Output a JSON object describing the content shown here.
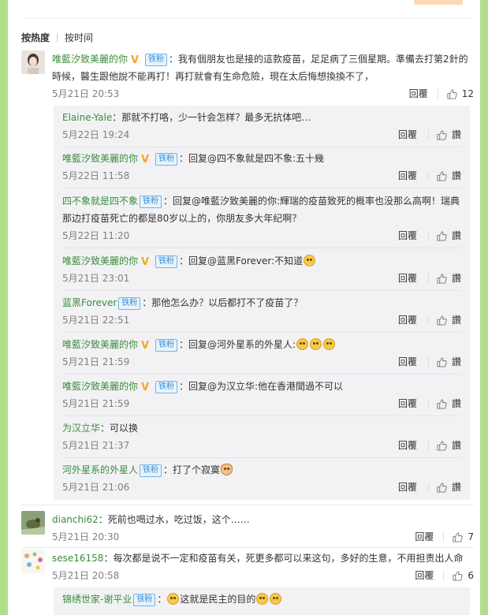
{
  "tabs": [
    {
      "label": "按热度",
      "active": true
    },
    {
      "label": "按时间",
      "active": false
    }
  ],
  "reply_label": "回覆",
  "like_label": "讚",
  "comments": [
    {
      "user": "唯藍汐致美麗的你",
      "fan_badge": "铁粉",
      "verified": true,
      "text": "：我有個朋友也是接的這款疫苗，足足病了三個星期。準備去打第2針的時候，醫生跟他說不能再打！再打就會有生命危險，現在太后悔想換換不了，",
      "time": "5月21日 20:53",
      "likes": "12",
      "replies": [
        {
          "user": "Elaine-Yale",
          "verified": false,
          "fan_badge": "",
          "text": "：那就不打咯，少一针会怎样？最多无抗体吧…",
          "time": "5月22日 19:24"
        },
        {
          "user": "唯藍汐致美麗的你",
          "verified": true,
          "fan_badge": "铁粉",
          "text": "：回复@四不象就是四不象:五十幾",
          "time": "5月22日 11:58"
        },
        {
          "user": "四不象就是四不象",
          "verified": false,
          "fan_badge": "铁粉",
          "text": "：回复@唯藍汐致美麗的你:輝瑞的疫苗致死的概率也没那么高啊！瑞典那边打疫苗死亡的都是80岁以上的，你朋友多大年纪啊？",
          "time": "5月22日 11:20"
        },
        {
          "user": "唯藍汐致美麗的你",
          "verified": true,
          "fan_badge": "铁粉",
          "text": "：回复@蓝黑Forever:不知道",
          "time": "5月21日 23:01"
        },
        {
          "user": "蓝黑Forever",
          "verified": false,
          "fan_badge": "铁粉",
          "text": "：那他怎么办？以后都打不了疫苗了？",
          "time": "5月21日 22:51"
        },
        {
          "user": "唯藍汐致美麗的你",
          "verified": true,
          "fan_badge": "铁粉",
          "text": "：回复@河外星系的外星人:",
          "time": "5月21日 21:59"
        },
        {
          "user": "唯藍汐致美麗的你",
          "verified": true,
          "fan_badge": "铁粉",
          "text": "：回复@为汉立华:他在香港間過不可以",
          "time": "5月21日 21:59"
        },
        {
          "user": "为汉立华",
          "verified": false,
          "fan_badge": "",
          "text": "：可以换",
          "time": "5月21日 21:37"
        },
        {
          "user": "河外星系的外星人",
          "verified": false,
          "fan_badge": "铁粉",
          "text": "：打了个寂寞",
          "time": "5月21日 21:06"
        }
      ]
    },
    {
      "user": "dianchi62",
      "verified": false,
      "fan_badge": "",
      "text": "：死前也喝过水，吃过饭，这个……",
      "time": "5月21日 20:30",
      "likes": "7"
    },
    {
      "user": "sese16158",
      "verified": false,
      "fan_badge": "",
      "text": "：每次都是说不一定和疫苗有关，死更多都可以来这句，多好的生意，不用担责出人命",
      "time": "5月21日 20:58",
      "likes": "6",
      "replies": [
        {
          "user": "锦绣世家-谢平业",
          "verified": false,
          "fan_badge": "铁粉",
          "text": "这就是民主的目的",
          "time": ""
        }
      ]
    }
  ]
}
